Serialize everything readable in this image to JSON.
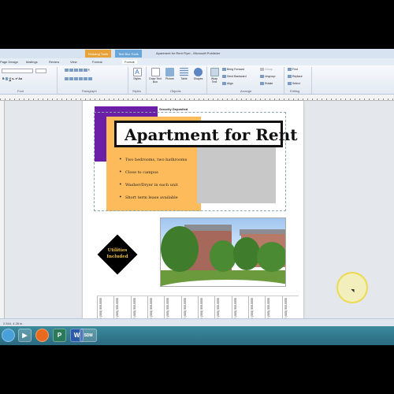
{
  "window": {
    "title": "Apartment for Rent Flyer - Microsoft Publisher",
    "context_tabs": [
      "Drawing Tools",
      "Text Box Tools"
    ]
  },
  "ribbon_tabs": [
    "Page Design",
    "Mailings",
    "Review",
    "View",
    "Format",
    "Format"
  ],
  "ribbon": {
    "groups": [
      "Font",
      "Paragraph",
      "Styles",
      "Objects",
      "Arrange",
      "Editing"
    ],
    "buttons": {
      "styles": "Styles",
      "draw_text_box": "Draw Text Box",
      "picture": "Picture",
      "table": "Table",
      "shapes": "Shapes",
      "wrap_text": "Wrap Text",
      "bring_forward": "Bring Forward",
      "send_backward": "Send Backward",
      "align": "Align",
      "group": "Group",
      "ungroup": "Ungroup",
      "rotate": "Rotate",
      "find": "Find",
      "replace": "Replace",
      "select": "Select"
    }
  },
  "flyer": {
    "header_small": "Security Deposited",
    "title": "Apartment for Rent",
    "bullets": [
      "Two bedrooms, two bathrooms",
      "Close to campus",
      "Washer/Dryer in each unit",
      "Short term lease available"
    ],
    "diamond_text": [
      "Utilities",
      "Included"
    ],
    "tear_off_label": "Contact Us! (555) 555-5555",
    "tear_off_count": 12
  },
  "status": {
    "position": "2.544, 4.28 in."
  },
  "taskbar": {
    "items": [
      "start",
      "explorer",
      "media",
      "firefox",
      "publisher",
      "word",
      "sdm"
    ],
    "sdm_label": "SDM"
  },
  "colors": {
    "purple": "#6a1fa6",
    "orange": "#fdbb5c",
    "title_border": "#111111",
    "diamond": "#000000",
    "diamond_text": "#f0c24b",
    "drawing_tools_tab": "#e8a23a",
    "text_box_tools_tab": "#6aa7d8"
  }
}
